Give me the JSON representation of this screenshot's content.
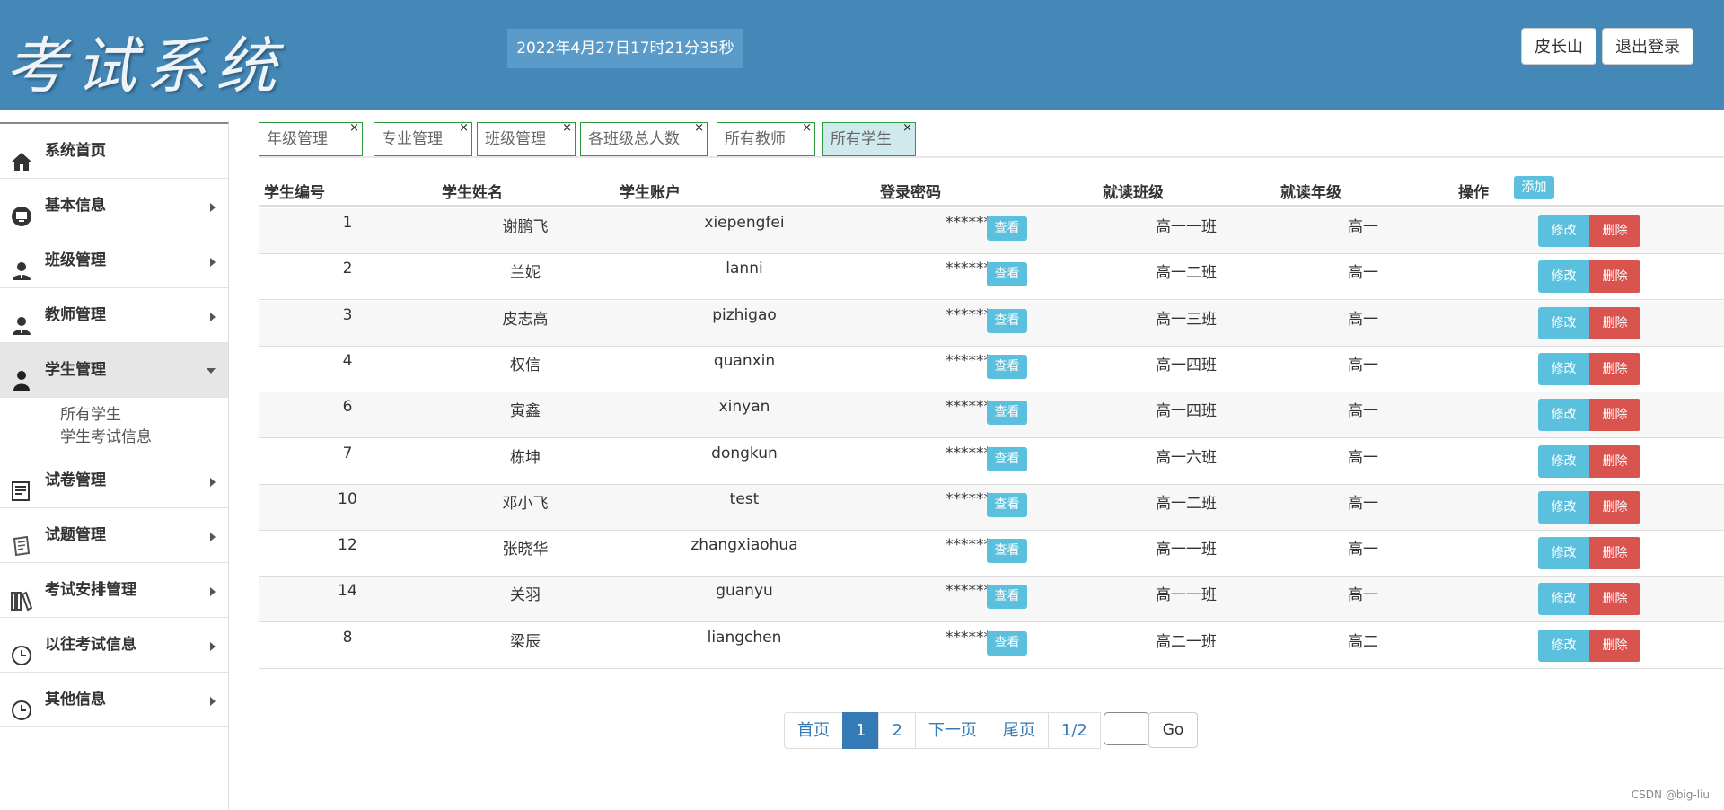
{
  "header": {
    "logo": "考试系统",
    "clock": "2022年4月27日17时21分35秒",
    "user_button": "皮长山",
    "logout_button": "退出登录"
  },
  "sidebar": {
    "items": [
      {
        "label": "系统首页",
        "icon": "home-icon",
        "arrow": false
      },
      {
        "label": "基本信息",
        "icon": "monitor-icon",
        "arrow": true
      },
      {
        "label": "班级管理",
        "icon": "user-icon",
        "arrow": true
      },
      {
        "label": "教师管理",
        "icon": "user-icon",
        "arrow": true
      },
      {
        "label": "学生管理",
        "icon": "person-icon",
        "arrow": "down"
      },
      {
        "label": "试卷管理",
        "icon": "document-icon",
        "arrow": true
      },
      {
        "label": "试题管理",
        "icon": "notes-icon",
        "arrow": true
      },
      {
        "label": "考试安排管理",
        "icon": "books-icon",
        "arrow": true
      },
      {
        "label": "以往考试信息",
        "icon": "clock-icon",
        "arrow": true
      },
      {
        "label": "其他信息",
        "icon": "clock-icon",
        "arrow": true
      }
    ],
    "submenu": [
      "所有学生",
      "学生考试信息"
    ]
  },
  "tabs": [
    {
      "label": "年级管理",
      "active": false
    },
    {
      "label": "专业管理",
      "active": false
    },
    {
      "label": "班级管理",
      "active": false
    },
    {
      "label": "各班级总人数",
      "active": false
    },
    {
      "label": "所有教师",
      "active": false
    },
    {
      "label": "所有学生",
      "active": true
    }
  ],
  "tab_close": "×",
  "table": {
    "headers": [
      "学生编号",
      "学生姓名",
      "学生账户",
      "登录密码",
      "就读班级",
      "就读年级",
      "操作"
    ],
    "add_button": "添加",
    "view_button": "查看",
    "edit_button": "修改",
    "delete_button": "删除",
    "rows": [
      {
        "id": "1",
        "name": "谢鹏飞",
        "account": "xiepengfei",
        "password": "******",
        "class": "高一一班",
        "grade": "高一"
      },
      {
        "id": "2",
        "name": "兰妮",
        "account": "lanni",
        "password": "******",
        "class": "高一二班",
        "grade": "高一"
      },
      {
        "id": "3",
        "name": "皮志高",
        "account": "pizhigao",
        "password": "******",
        "class": "高一三班",
        "grade": "高一"
      },
      {
        "id": "4",
        "name": "权信",
        "account": "quanxin",
        "password": "******",
        "class": "高一四班",
        "grade": "高一"
      },
      {
        "id": "6",
        "name": "寅鑫",
        "account": "xinyan",
        "password": "******",
        "class": "高一四班",
        "grade": "高一"
      },
      {
        "id": "7",
        "name": "栋坤",
        "account": "dongkun",
        "password": "******",
        "class": "高一六班",
        "grade": "高一"
      },
      {
        "id": "10",
        "name": "邓小飞",
        "account": "test",
        "password": "******",
        "class": "高一二班",
        "grade": "高一"
      },
      {
        "id": "12",
        "name": "张晓华",
        "account": "zhangxiaohua",
        "password": "******",
        "class": "高一一班",
        "grade": "高一"
      },
      {
        "id": "14",
        "name": "关羽",
        "account": "guanyu",
        "password": "******",
        "class": "高一一班",
        "grade": "高一"
      },
      {
        "id": "8",
        "name": "梁辰",
        "account": "liangchen",
        "password": "******",
        "class": "高二一班",
        "grade": "高二"
      }
    ]
  },
  "pagination": {
    "first": "首页",
    "pages": [
      "1",
      "2"
    ],
    "current": "1",
    "next": "下一页",
    "last": "尾页",
    "page_info": "1/2",
    "go": "Go"
  },
  "watermark": "CSDN @big-liu"
}
